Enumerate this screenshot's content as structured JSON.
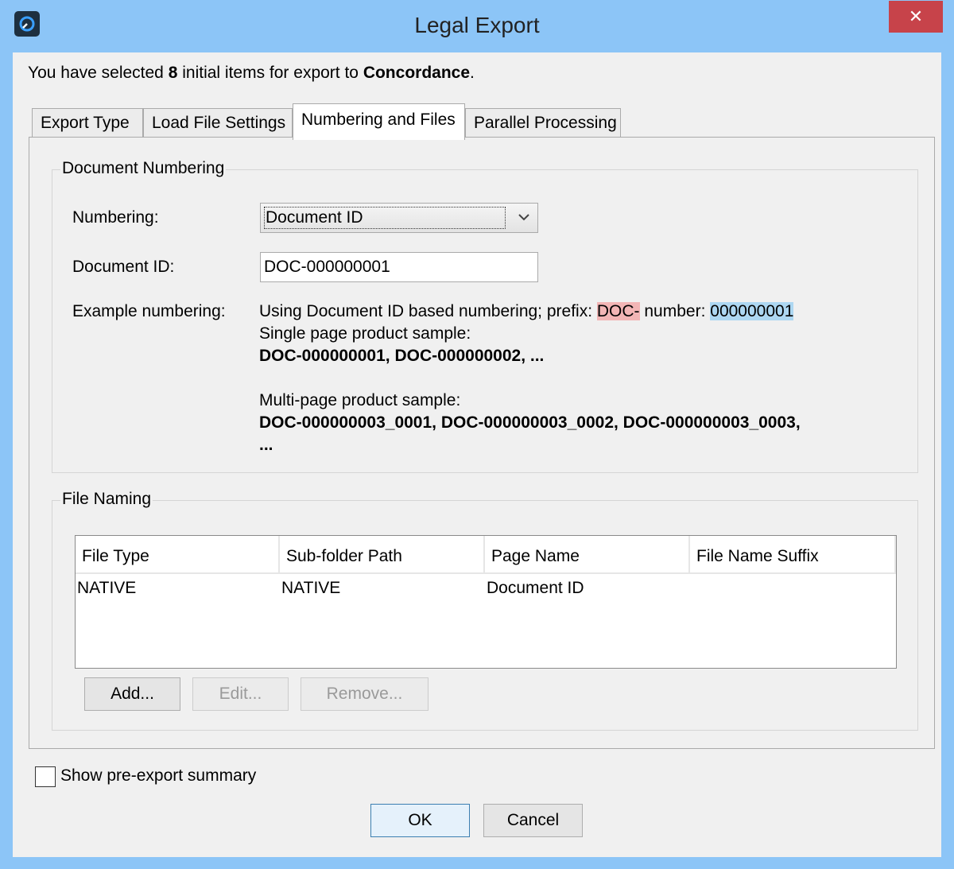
{
  "window": {
    "title": "Legal Export",
    "close_glyph": "✕"
  },
  "summary": {
    "prefix": "You have selected ",
    "count": "8",
    "middle": " initial items for export to ",
    "target": "Concordance",
    "suffix": "."
  },
  "tabs": [
    {
      "label": "Export Type",
      "active": false
    },
    {
      "label": "Load File Settings",
      "active": false
    },
    {
      "label": "Numbering and Files",
      "active": true
    },
    {
      "label": "Parallel Processing",
      "active": false
    }
  ],
  "document_numbering": {
    "legend": "Document Numbering",
    "numbering_label": "Numbering:",
    "numbering_value": "Document ID",
    "document_id_label": "Document ID:",
    "document_id_value": "DOC-000000001",
    "example_label": "Example numbering:",
    "example_line1_prefix": "Using Document ID based numbering; prefix: ",
    "example_prefix_value": "DOC-",
    "example_number_label": " number: ",
    "example_number_value": "000000001",
    "single_page_label": "Single page product sample:",
    "single_page_sample": "DOC-000000001, DOC-000000002, ...",
    "multi_page_label": "Multi-page product sample:",
    "multi_page_sample_line1": "DOC-000000003_0001, DOC-000000003_0002, DOC-000000003_0003,",
    "multi_page_sample_line2": "..."
  },
  "file_naming": {
    "legend": "File Naming",
    "columns": [
      "File Type",
      "Sub-folder Path",
      "Page Name",
      "File Name Suffix"
    ],
    "rows": [
      [
        "NATIVE",
        "NATIVE",
        "Document ID",
        ""
      ]
    ],
    "add_label": "Add...",
    "edit_label": "Edit...",
    "remove_label": "Remove..."
  },
  "footer": {
    "show_summary_label": "Show pre-export summary",
    "show_summary_checked": false,
    "ok_label": "OK",
    "cancel_label": "Cancel"
  },
  "icons": {
    "app": "app-logo-icon",
    "close": "close-icon",
    "dropdown": "chevron-down-icon",
    "checkbox": "checkbox-icon"
  },
  "colors": {
    "title_bar": "#8cc5f7",
    "close_button": "#c7434a",
    "prefix_highlight": "#f2b5b5",
    "number_highlight": "#add7f2"
  }
}
